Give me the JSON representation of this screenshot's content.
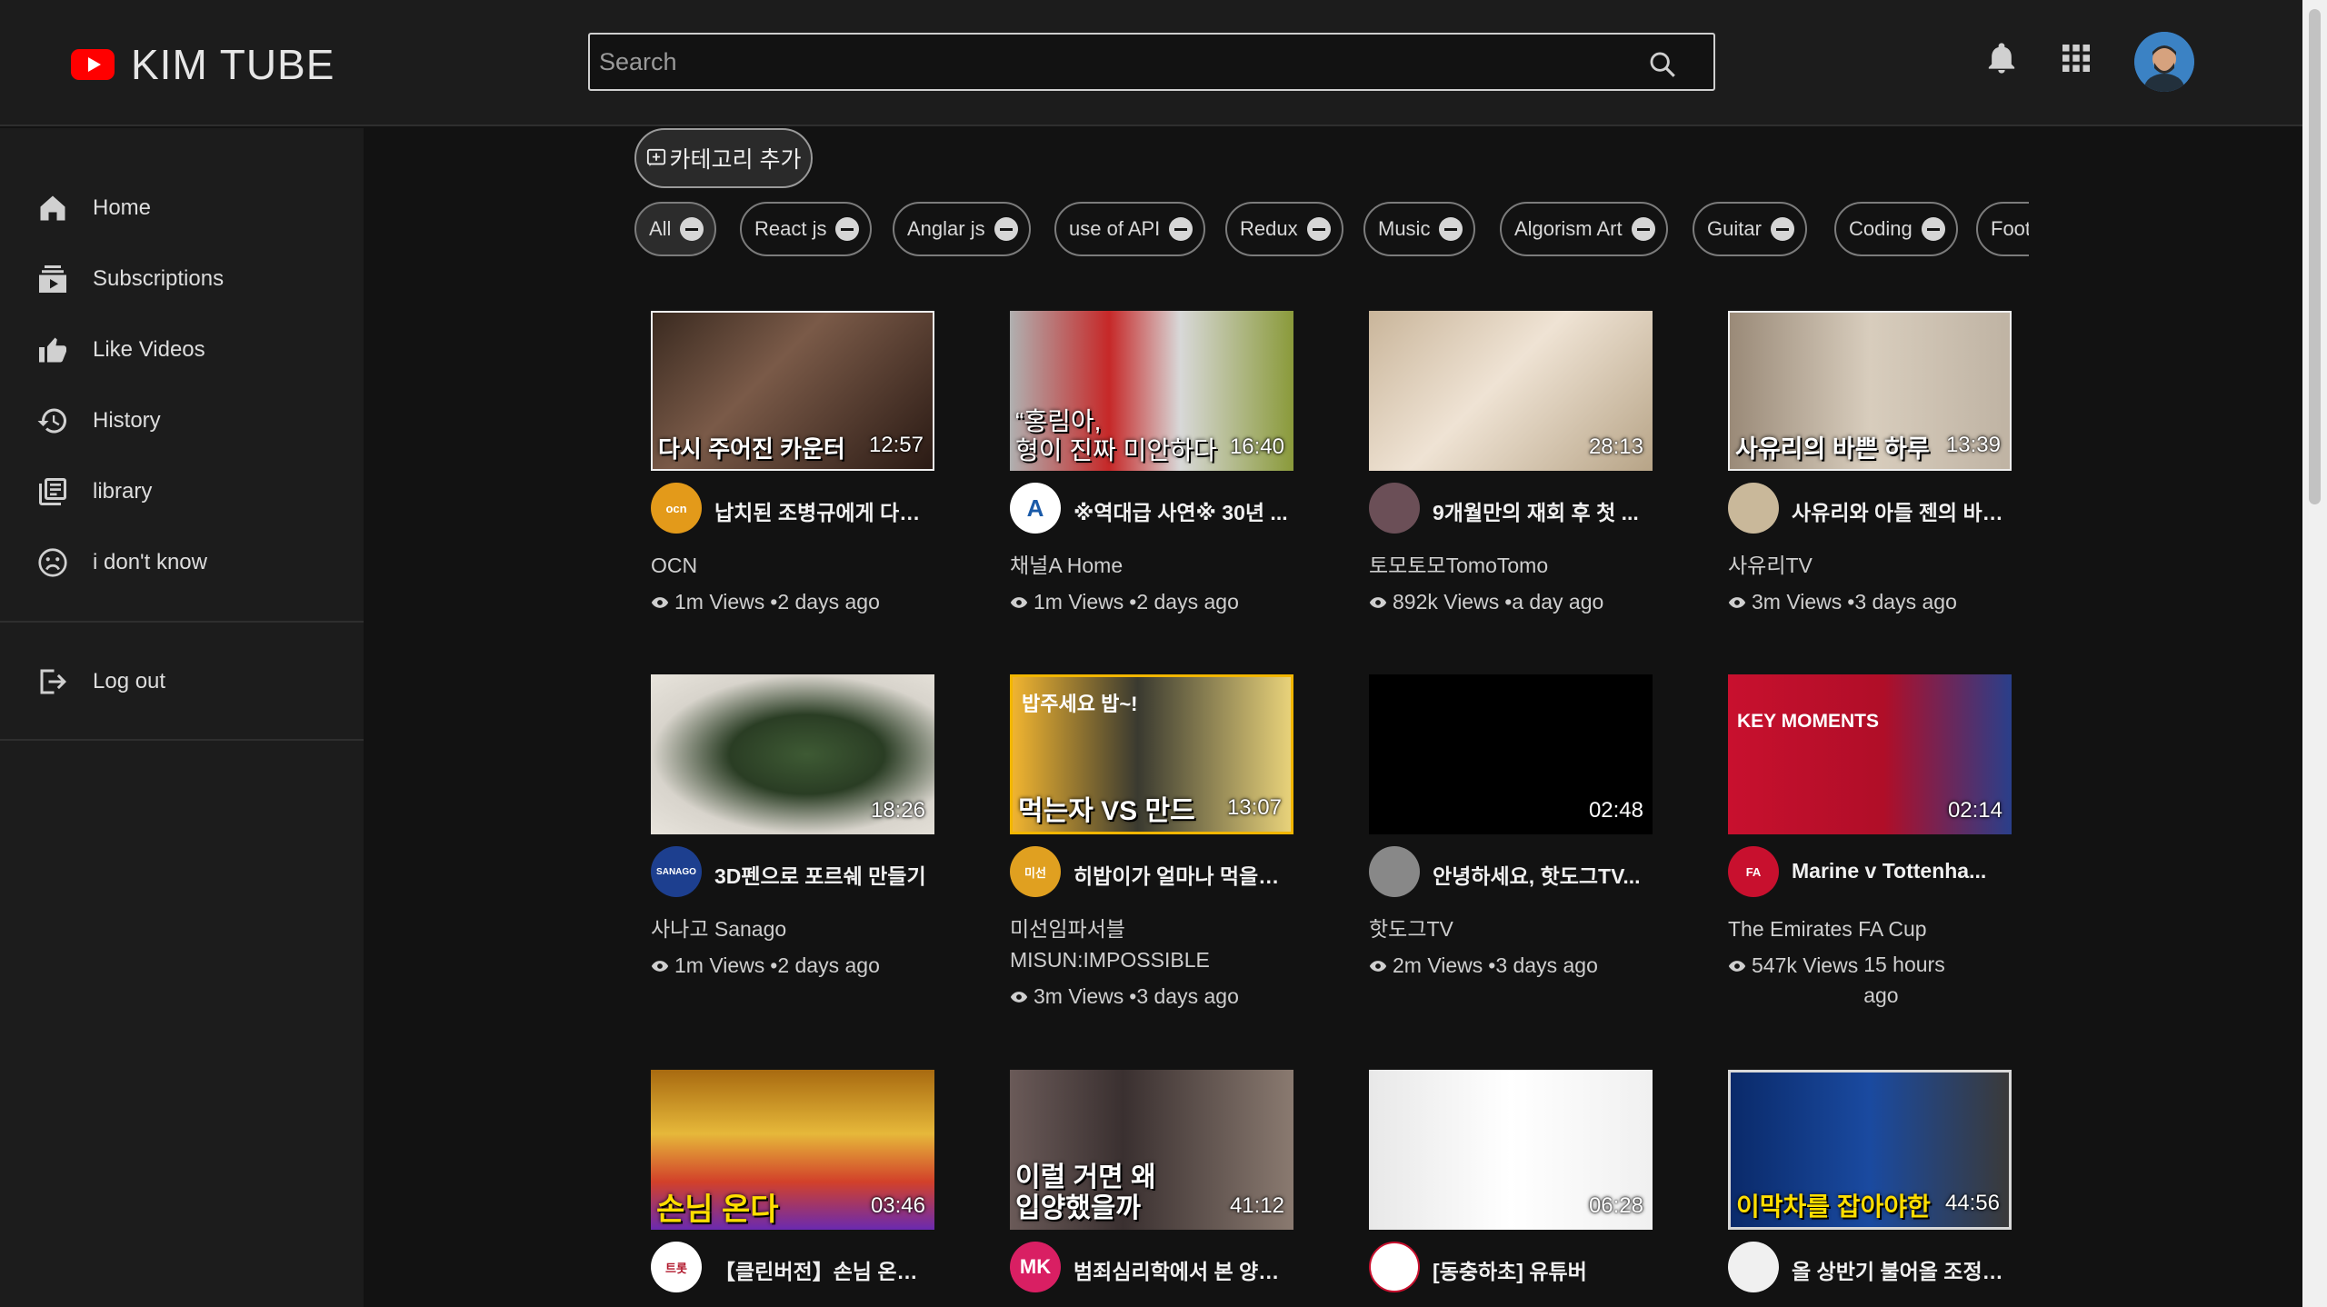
{
  "app": {
    "title": "KIM TUBE"
  },
  "search": {
    "placeholder": "Search"
  },
  "sidebar": {
    "items": [
      {
        "label": "Home",
        "icon": "home-icon"
      },
      {
        "label": "Subscriptions",
        "icon": "subscriptions-icon"
      },
      {
        "label": "Like Videos",
        "icon": "thumbs-up-icon"
      },
      {
        "label": "History",
        "icon": "history-icon"
      },
      {
        "label": "library",
        "icon": "library-icon"
      },
      {
        "label": "i don't know",
        "icon": "sad-face-icon"
      }
    ],
    "logout": {
      "label": "Log out",
      "icon": "logout-icon"
    }
  },
  "categories": {
    "add_label": "카테고리 추가",
    "chips": [
      "All",
      "React js",
      "Anglar js",
      "use of API",
      "Redux",
      "Music",
      "Algorism Art",
      "Guitar",
      "Coding",
      "Foot"
    ],
    "active": "All"
  },
  "videos": [
    {
      "duration": "12:57",
      "caption": "다시 주어진 카운터",
      "caption_top": "",
      "title": "납치된 조병규에게 다시 ...",
      "channel": "OCN",
      "views": "1m Views",
      "age": "•2 days ago",
      "avatar_text": "ocn",
      "avatar_color": "#e39a1a"
    },
    {
      "duration": "16:40",
      "caption": "“홍림아,\n형이 진짜 미안하다",
      "caption_top": "",
      "title": "※역대급 사연※ 30년 ...",
      "channel": "채널A Home",
      "views": "1m Views",
      "age": "•2 days ago",
      "avatar_text": "A",
      "avatar_color": "#ffffff"
    },
    {
      "duration": "28:13",
      "caption": "",
      "caption_top": "",
      "title": "9개월만의 재회 후 첫 ...",
      "channel": "토모토모TomoTomo",
      "views": "892k Views",
      "age": "•a day ago",
      "avatar_text": "",
      "avatar_color": "#6b4f57"
    },
    {
      "duration": "13:39",
      "caption": "사유리의 바쁜 하루",
      "caption_top": "",
      "title": "사유리와 아들 젠의 바쁜...",
      "channel": "사유리TV",
      "views": "3m Views",
      "age": "•3 days ago",
      "avatar_text": "",
      "avatar_color": "#c9b89a"
    },
    {
      "duration": "18:26",
      "caption": "",
      "caption_top": "",
      "title": "3D펜으로 포르쉐 만들기",
      "channel": "사나고 Sanago",
      "views": "1m Views",
      "age": "•2 days ago",
      "avatar_text": "SANAGO",
      "avatar_color": "#1d3f8f"
    },
    {
      "duration": "13:07",
      "caption": "먹는자 VS 만드",
      "caption_top": "밥주세요 밥~!",
      "title": "히밥이가 얼마나 먹을지 ...",
      "channel": "미선임파서블 MISUN:IMPOSSIBLE",
      "views": "3m Views",
      "age": "•3 days ago",
      "avatar_text": "미선",
      "avatar_color": "#e0a020"
    },
    {
      "duration": "02:48",
      "caption": "",
      "caption_top": "",
      "title": "안녕하세요, 핫도그TV...",
      "channel": "핫도그TV",
      "views": "2m Views",
      "age": "•3 days ago",
      "avatar_text": "",
      "avatar_color": "#888888"
    },
    {
      "duration": "02:14",
      "caption": "",
      "caption_top": "KEY MOMENTS",
      "title": "Marine v Tottenha...",
      "channel": "The Emirates FA Cup",
      "views": "547k Views",
      "age": "15 hours ago",
      "avatar_text": "FA",
      "avatar_color": "#c8102e"
    },
    {
      "duration": "03:46",
      "caption": "손님 온다",
      "caption_top": "",
      "title": "【클린버전】손님 온다 - ...",
      "channel": "",
      "views": "",
      "age": "",
      "avatar_text": "트롯",
      "avatar_color": "#ffffff"
    },
    {
      "duration": "41:12",
      "caption": "이럴 거면 왜\n입양했을까",
      "caption_top": "",
      "title": "범죄심리학에서 본 양부...",
      "channel": "",
      "views": "",
      "age": "",
      "avatar_text": "MK",
      "avatar_color": "#d91f63"
    },
    {
      "duration": "06:28",
      "caption": "",
      "caption_top": "",
      "title": "[동충하초] 유튜버",
      "channel": "",
      "views": "",
      "age": "",
      "avatar_text": "",
      "avatar_color": "#ffffff"
    },
    {
      "duration": "44:56",
      "caption": "이막차를 잡아야한",
      "caption_top": "",
      "title": "올 상반기 불어올 조정의...",
      "channel": "",
      "views": "",
      "age": "",
      "avatar_text": "",
      "avatar_color": "#f0f0f0"
    }
  ],
  "colors": {
    "background": "#121212",
    "panel": "#1c1c1c",
    "brand": "#ff0000"
  }
}
